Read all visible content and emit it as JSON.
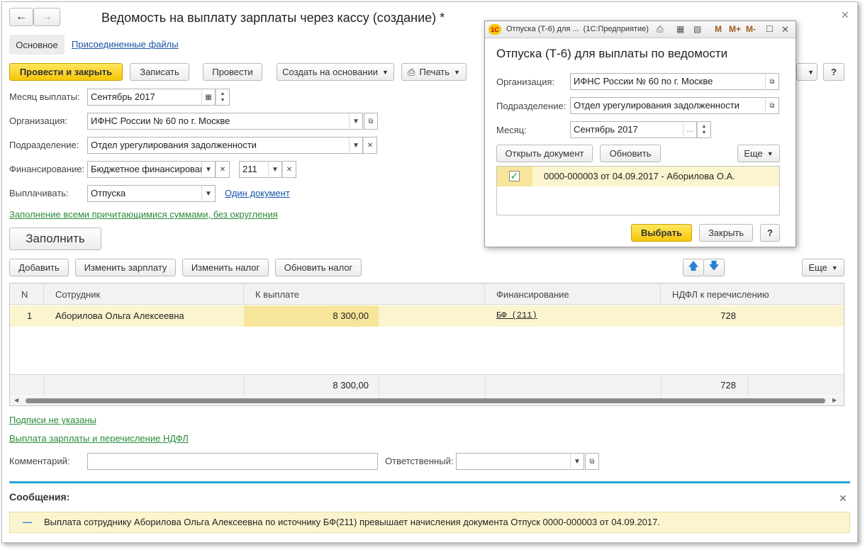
{
  "form": {
    "title": "Ведомость на выплату зарплаты через кассу (создание) *",
    "tabs": [
      "Основное",
      "Присоединенные файлы"
    ],
    "toolbar": {
      "post_close": "Провести и закрыть",
      "save": "Записать",
      "post": "Провести",
      "create_based": "Создать на основании",
      "print": "Печать",
      "more": "Еще",
      "help": "?"
    },
    "fields": {
      "month_label": "Месяц выплаты:",
      "month_value": "Сентябрь 2017",
      "org_label": "Организация:",
      "org_value": "ИФНС России № 60 по г. Москве",
      "dept_label": "Подразделение:",
      "dept_value": "Отдел урегулирования задолженности",
      "fin_label": "Финансирование:",
      "fin_value": "Бюджетное финансировані",
      "fin_code": "211",
      "pay_label": "Выплачивать:",
      "pay_value": "Отпуска",
      "one_doc_link": "Один документ"
    },
    "fill_mode_link": "Заполнение всеми причитающимися суммами, без округления",
    "fill_button": "Заполнить",
    "table_toolbar": {
      "add": "Добавить",
      "change_salary": "Изменить зарплату",
      "change_tax": "Изменить налог",
      "update_tax": "Обновить налог",
      "more": "Еще"
    },
    "table": {
      "columns": [
        "N",
        "Сотрудник",
        "К выплате",
        "Финансирование",
        "НДФЛ к перечислению"
      ],
      "rows": [
        {
          "n": "1",
          "employee": "Аборилова Ольга Алексеевна",
          "amount": "8 300,00",
          "financing": "БФ (211)",
          "ndfl": "728"
        }
      ],
      "totals": {
        "amount": "8 300,00",
        "ndfl": "728"
      }
    },
    "signatures_link": "Подписи не указаны",
    "payment_link": "Выплата зарплаты и перечисление НДФЛ",
    "comment_label": "Комментарий:",
    "comment_value": "",
    "responsible_label": "Ответственный:",
    "responsible_value": ""
  },
  "messages": {
    "title": "Сообщения:",
    "items": [
      "Выплата сотруднику Аборилова Ольга Алексеевна по источнику БФ(211) превышает начисления документа Отпуск 0000-000003 от 04.09.2017."
    ]
  },
  "popup": {
    "window_title": "Отпуска (Т-6) для ...  (1С:Предприятие)",
    "titlebar_icons": [
      "M",
      "M+",
      "M-"
    ],
    "heading": "Отпуска (Т-6) для выплаты по ведомости",
    "org_label": "Организация:",
    "org_value": "ИФНС России № 60 по г. Москве",
    "dept_label": "Подразделение:",
    "dept_value": "Отдел урегулирования задолженности",
    "month_label": "Месяц:",
    "month_value": "Сентябрь 2017",
    "open_doc": "Открыть документ",
    "refresh": "Обновить",
    "more": "Еще",
    "items": [
      {
        "checked": true,
        "label": "0000-000003 от 04.09.2017 - Аборилова О.А."
      }
    ],
    "select": "Выбрать",
    "close": "Закрыть",
    "help": "?"
  },
  "colors": {
    "accent_yellow": "#f6c70a",
    "selected_row": "#fbf5cf",
    "link_blue": "#1a54a6",
    "link_green": "#2a8a3a",
    "divider_blue": "#2aa3d8"
  }
}
